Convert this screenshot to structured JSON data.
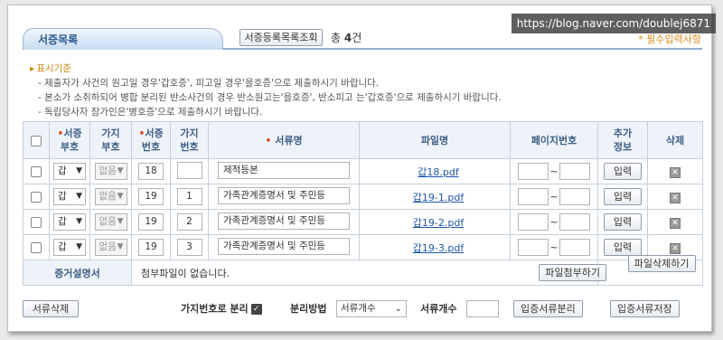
{
  "watermark": "https://blog.naver.com/doublej6871",
  "header": {
    "tab_title": "서증목록",
    "list_button": "서증등록목록조회",
    "total_label": "총",
    "total_count": "4",
    "total_unit": "건",
    "required_note": "* 필수입력사항"
  },
  "criteria": {
    "title": "표시기준",
    "lines": [
      "- 제출자가 사건의 원고일 경우'갑호증', 피고일 경우'을호증'으로 제출하시기 바랍니다.",
      "- 본소가 소취하되어 병합 분리된 반소사건의 경우 반소원고는'을호증', 반소피고 는'갑호증'으로 제출하시기 바랍니다.",
      "- 독립당사자 참가인은'병호증'으로 제출하시기 바랍니다."
    ]
  },
  "table": {
    "headers": {
      "evidence_code": [
        "서증",
        "부호"
      ],
      "branch_code": [
        "가지",
        "부호"
      ],
      "evidence_no": [
        "서증",
        "번호"
      ],
      "branch_no": [
        "가지",
        "번호"
      ],
      "doc_name": "서류명",
      "file_name": "파일명",
      "page_no": "페이지번호",
      "extra_info": [
        "추가",
        "정보"
      ],
      "delete": "삭제"
    },
    "rows": [
      {
        "code": "갑",
        "branch": "없음",
        "no": "18",
        "branch_no": "",
        "name": "제적등본",
        "file": "갑18.pdf",
        "btn": "입력"
      },
      {
        "code": "갑",
        "branch": "없음",
        "no": "19",
        "branch_no": "1",
        "name": "가족관계증명서 및 주민등",
        "file": "갑19-1.pdf",
        "btn": "입력"
      },
      {
        "code": "갑",
        "branch": "없음",
        "no": "19",
        "branch_no": "2",
        "name": "가족관계증명서 및 주민등",
        "file": "갑19-2.pdf",
        "btn": "입력"
      },
      {
        "code": "갑",
        "branch": "없음",
        "no": "19",
        "branch_no": "3",
        "name": "가족관계증명서 및 주민등",
        "file": "갑19-3.pdf",
        "btn": "입력"
      }
    ],
    "page_dash": "~",
    "evidence_desc": {
      "label": "증거설명서",
      "text": "첨부파일이 없습니다.",
      "attach_button": "파일첨부하기",
      "delete_button": "파일삭제하기"
    }
  },
  "bottom": {
    "doc_delete": "서류삭제",
    "branch_split_label": "가지번호로 분리",
    "split_method_label": "분리방법",
    "split_method_value": "서류개수",
    "doc_count_label": "서류개수",
    "split_button": "입증서류분리",
    "save_button": "입증서류저장"
  }
}
